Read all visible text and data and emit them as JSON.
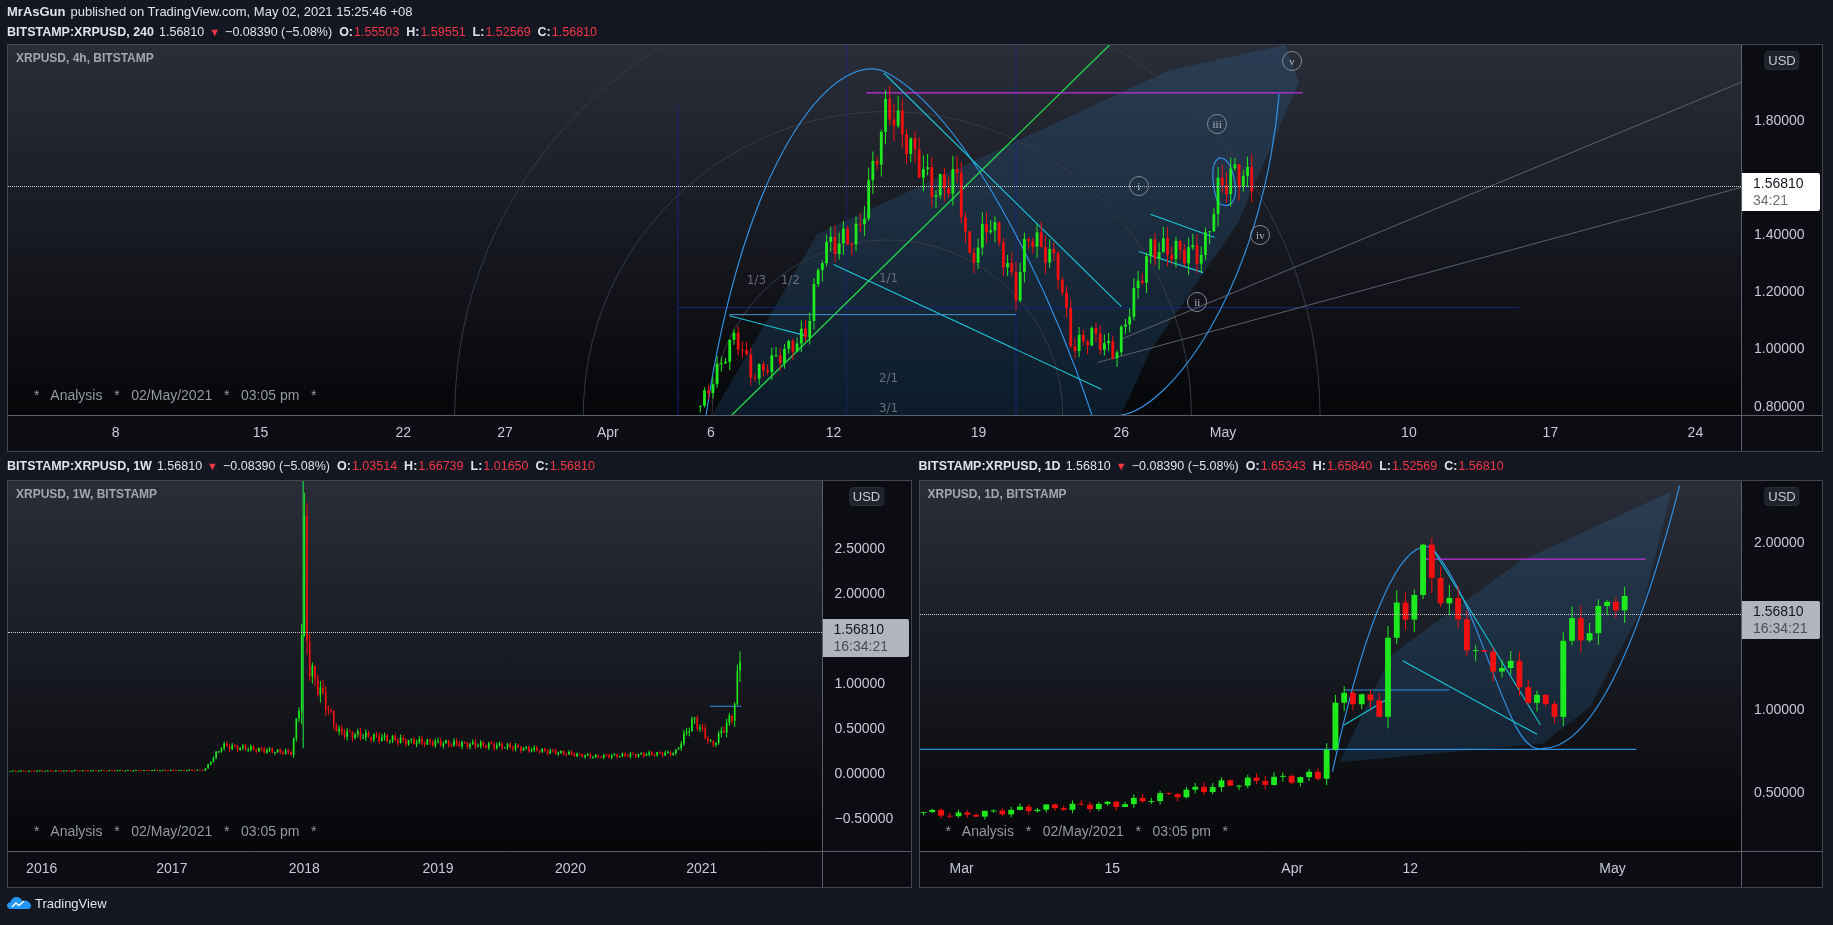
{
  "header": {
    "author": "MrAsGun",
    "published_line": "published on TradingView.com, May 02, 2021 15:25:46 +08"
  },
  "panel_rows": [
    [
      {
        "legend": {
          "symbol": "BITSTAMP:XRPUSD, 240",
          "price": "1.56810",
          "direction": "▼",
          "change": "−0.08390 (−5.08%)",
          "ohlc": [
            {
              "label": "O:",
              "value": "1.55503"
            },
            {
              "label": "H:",
              "value": "1.59551"
            },
            {
              "label": "L:",
              "value": "1.52569"
            },
            {
              "label": "C:",
              "value": "1.56810"
            }
          ]
        },
        "title": "XRPUSD, 4h, BITSTAMP",
        "currency": "USD",
        "price_ticks": [
          "1.80000",
          "1.40000",
          "1.20000",
          "1.00000",
          "0.80000"
        ],
        "last_price": {
          "price": "1.56810",
          "countdown": "34:21",
          "highlighted": true
        },
        "time_ticks": [
          "8",
          "15",
          "22",
          "27",
          "Apr",
          "6",
          "12",
          "19",
          "26",
          "May",
          "10",
          "17",
          "24"
        ],
        "annotations": [
          {
            "kind": "wave",
            "text": "v"
          },
          {
            "kind": "wave",
            "text": "iii"
          },
          {
            "kind": "wave",
            "text": "i"
          },
          {
            "kind": "wave",
            "text": "iv"
          },
          {
            "kind": "ratio",
            "text": "1/3"
          },
          {
            "kind": "ratio",
            "text": "1/2"
          },
          {
            "kind": "ratio",
            "text": "1/1"
          },
          {
            "kind": "wave",
            "text": "ii"
          },
          {
            "kind": "ratio",
            "text": "2/1"
          },
          {
            "kind": "ratio",
            "text": "3/1"
          }
        ],
        "analysis": "*   Analysis   *   02/May/2021   *   03:05 pm   *"
      }
    ],
    [
      {
        "legend": {
          "symbol": "BITSTAMP:XRPUSD, 1W",
          "price": "1.56810",
          "direction": "▼",
          "change": "−0.08390 (−5.08%)",
          "ohlc": [
            {
              "label": "O:",
              "value": "1.03514"
            },
            {
              "label": "H:",
              "value": "1.66739"
            },
            {
              "label": "L:",
              "value": "1.01650"
            },
            {
              "label": "C:",
              "value": "1.56810"
            }
          ]
        },
        "title": "XRPUSD, 1W, BITSTAMP",
        "currency": "USD",
        "price_ticks": [
          "2.50000",
          "2.00000",
          "1.00000",
          "0.50000",
          "0.00000",
          "−0.50000"
        ],
        "last_price": {
          "price": "1.56810",
          "countdown": "16:34:21",
          "highlighted": false
        },
        "time_ticks": [
          "2016",
          "2017",
          "2018",
          "2019",
          "2020",
          "2021"
        ],
        "analysis": "*   Analysis   *   02/May/2021   *   03:05 pm   *"
      },
      {
        "legend": {
          "symbol": "BITSTAMP:XRPUSD, 1D",
          "price": "1.56810",
          "direction": "▼",
          "change": "−0.08390 (−5.08%)",
          "ohlc": [
            {
              "label": "O:",
              "value": "1.65343"
            },
            {
              "label": "H:",
              "value": "1.65840"
            },
            {
              "label": "L:",
              "value": "1.52569"
            },
            {
              "label": "C:",
              "value": "1.56810"
            }
          ]
        },
        "title": "XRPUSD, 1D, BITSTAMP",
        "currency": "USD",
        "price_ticks": [
          "2.00000",
          "1.00000",
          "0.50000"
        ],
        "last_price": {
          "price": "1.56810",
          "countdown": "16:34:21",
          "highlighted": false
        },
        "time_ticks": [
          "Mar",
          "15",
          "Apr",
          "12",
          "May"
        ],
        "analysis": "*   Analysis   *   02/May/2021   *   03:05 pm   *"
      }
    ]
  ],
  "footer": {
    "brand": "TradingView"
  }
}
